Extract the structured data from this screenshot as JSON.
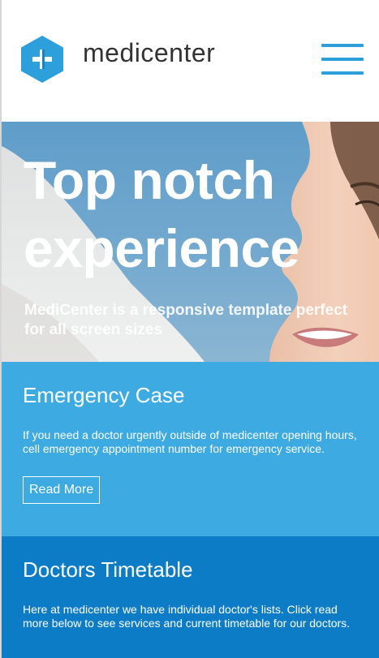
{
  "header": {
    "brand": "medicenter",
    "logo_icon": "plus-hexagon-icon",
    "menu_icon": "hamburger-menu-icon",
    "colors": {
      "accent": "#2d9fdb",
      "brand_text": "#333333"
    }
  },
  "hero": {
    "title_line1": "Top notch",
    "title_line2": "experience",
    "subtitle": "MediCenter is a responsive template perfect for all screen sizes"
  },
  "emergency": {
    "title": "Emergency Case",
    "text": "If you need a doctor urgently outside of medicenter opening hours, cell emergency appointment number for emergency service.",
    "button_label": "Read More",
    "bg_color": "#3daae2"
  },
  "timetable": {
    "title": "Doctors Timetable",
    "text": "Here at medicenter we have individual doctor's lists. Click read more below to see services and current timetable for our doctors.",
    "bg_color": "#0d7cc6"
  }
}
